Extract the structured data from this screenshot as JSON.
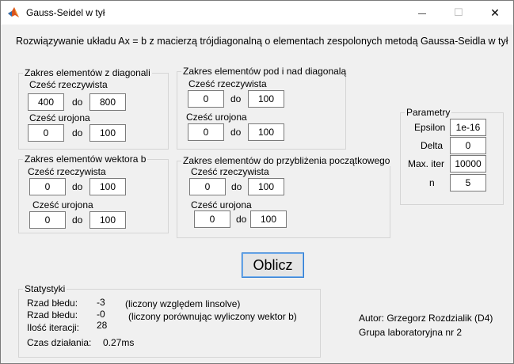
{
  "window": {
    "title": "Gauss-Seidel w tył",
    "controls": {
      "minimize": "—",
      "maximize": "☐",
      "close": "✕"
    },
    "icon": "matlab-icon"
  },
  "heading": "Rozwiązywanie układu Ax = b z macierzą trójdiagonalną o elementach zespolonych metodą Gaussa-Seidla w tył",
  "groups": {
    "diag": {
      "title": "Zakres elementów z diagonali",
      "real_label": "Cześć rzeczywista",
      "imag_label": "Cześć urojona",
      "do": "do",
      "real_from": "400",
      "real_to": "800",
      "imag_from": "0",
      "imag_to": "100"
    },
    "offdiag": {
      "title": "Zakres elementów pod i nad diagonalą",
      "real_label": "Cześć rzeczywista",
      "imag_label": "Cześć urojona",
      "do": "do",
      "real_from": "0",
      "real_to": "100",
      "imag_from": "0",
      "imag_to": "100"
    },
    "vecb": {
      "title": "Zakres elementów wektora b",
      "real_label": "Cześć rzeczywista",
      "imag_label": "Cześć urojona",
      "do": "do",
      "real_from": "0",
      "real_to": "100",
      "imag_from": "0",
      "imag_to": "100"
    },
    "init": {
      "title": "Zakres elementów do przybliżenia początkowego",
      "real_label": "Cześć rzeczywista",
      "imag_label": "Cześć urojona",
      "do": "do",
      "real_from": "0",
      "real_to": "100",
      "imag_from": "0",
      "imag_to": "100"
    }
  },
  "params": {
    "title": "Parametry",
    "epsilon_label": "Epsilon",
    "epsilon": "1e-16",
    "delta_label": "Delta",
    "delta": "0",
    "maxiter_label": "Max. iter",
    "maxiter": "10000",
    "n_label": "n",
    "n": "5"
  },
  "compute_button": "Oblicz",
  "stats": {
    "title": "Statystyki",
    "err1_label": "Rzad błedu:",
    "err1_value": "-3",
    "err1_note": "(liczony względem linsolve)",
    "err2_label": "Rzad błedu:",
    "err2_value": "-0",
    "err2_note": "(liczony porównując wyliczony wektor b)",
    "iter_label": "Ilość iteracji:",
    "iter_value": "28",
    "time_label": "Czas działania:",
    "time_value": "0.27ms"
  },
  "author": {
    "line1": "Autor: Grzegorz Rozdzialik (D4)",
    "line2": "Grupa laboratoryjna nr 2"
  }
}
